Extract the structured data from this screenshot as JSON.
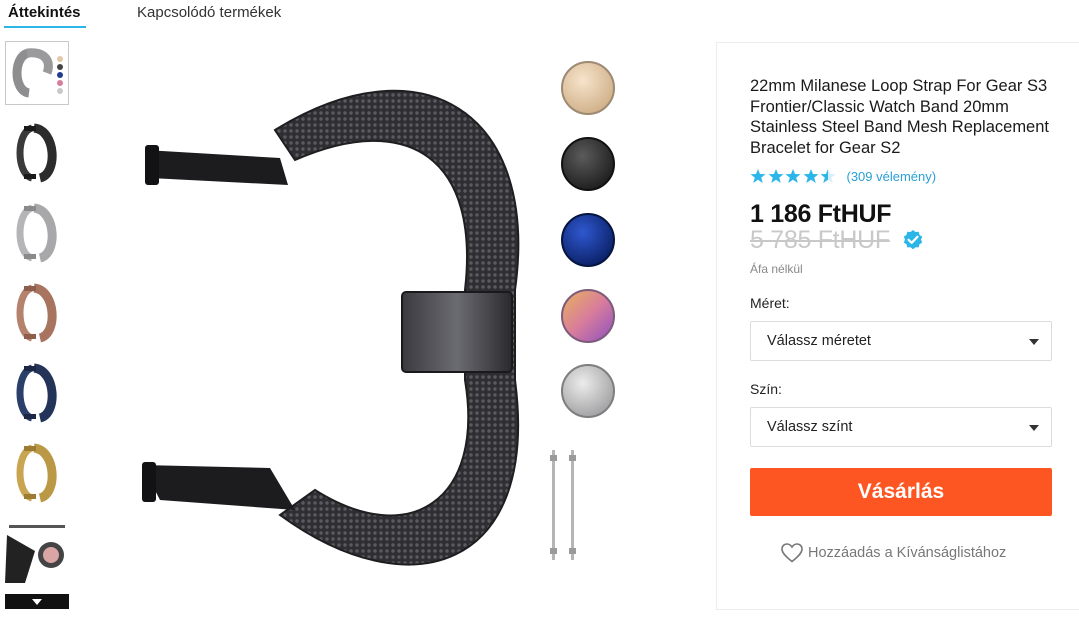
{
  "tabs": [
    {
      "label": "Áttekintés",
      "active": true
    },
    {
      "label": "Kapcsolódó termékek",
      "active": false
    }
  ],
  "thumbnails": [
    {
      "name": "thumb-silver-colors",
      "color": "#8e8e90"
    },
    {
      "name": "thumb-black",
      "color": "#3a3a3a"
    },
    {
      "name": "thumb-silver",
      "color": "#b5b5b7"
    },
    {
      "name": "thumb-rose-gold",
      "color": "#b5826d"
    },
    {
      "name": "thumb-blue",
      "color": "#2b3f6b"
    },
    {
      "name": "thumb-gold",
      "color": "#c9a552"
    },
    {
      "name": "thumb-detail",
      "color": "#222222"
    }
  ],
  "color_swatches": [
    {
      "name": "gold",
      "color": "#e6c9a4"
    },
    {
      "name": "black",
      "color": "#2e2e2e"
    },
    {
      "name": "blue",
      "color": "#0e2e8c"
    },
    {
      "name": "rainbow",
      "color": "#d67f9d"
    },
    {
      "name": "silver",
      "color": "#b9b9bb"
    }
  ],
  "product": {
    "title": "22mm Milanese Loop Strap For Gear S3 Frontier/Classic Watch Band 20mm Stainless Steel Band Mesh Replacement Bracelet for Gear S2",
    "rating": 4.5,
    "reviews_label": "(309 vélemény)",
    "price": "1 186 FtHUF",
    "old_price": "5 785 FtHUF",
    "vat_note": "Áfa nélkül",
    "size_label": "Méret:",
    "size_placeholder": "Válassz méretet",
    "color_label": "Szín:",
    "color_placeholder": "Válassz színt",
    "buy_label": "Vásárlás",
    "wishlist_label": "Hozzáadás a Kívánságlistához"
  },
  "colors": {
    "accent": "#2cb6e8",
    "star": "#2cb6e8",
    "buy": "#fe5622",
    "link": "#2a9fd6"
  }
}
